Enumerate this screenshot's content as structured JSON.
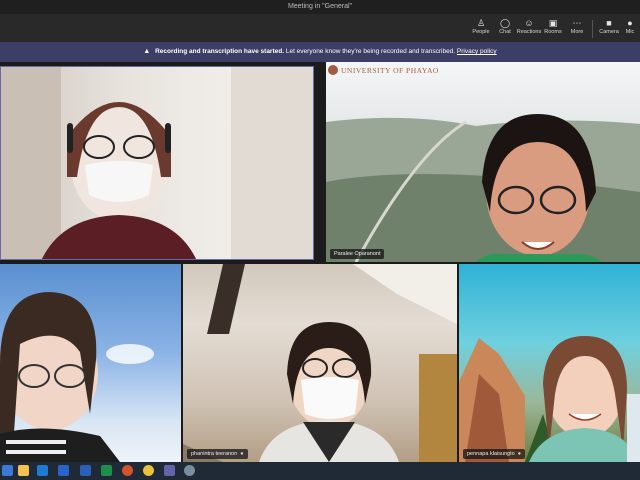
{
  "window": {
    "title": "Meeting in \"General\""
  },
  "toolbar": {
    "people": "People",
    "chat": "Chat",
    "reactions": "Reactions",
    "rooms": "Rooms",
    "more": "More",
    "camera": "Camera",
    "mic": "Mic"
  },
  "banner": {
    "bold": "Recording and transcription have started.",
    "text": "Let everyone know they're being recorded and transcribed.",
    "link": "Privacy policy"
  },
  "participants": {
    "t2_name": "Paralee Oparanont",
    "t4_name": "phanintra teeranon",
    "t5_name": "pennapa klaisungto"
  },
  "background": {
    "university": "UNIVERSITY OF PHAYAO"
  },
  "colors": {
    "banner": "#3d3e66",
    "toolbar": "#292929"
  }
}
